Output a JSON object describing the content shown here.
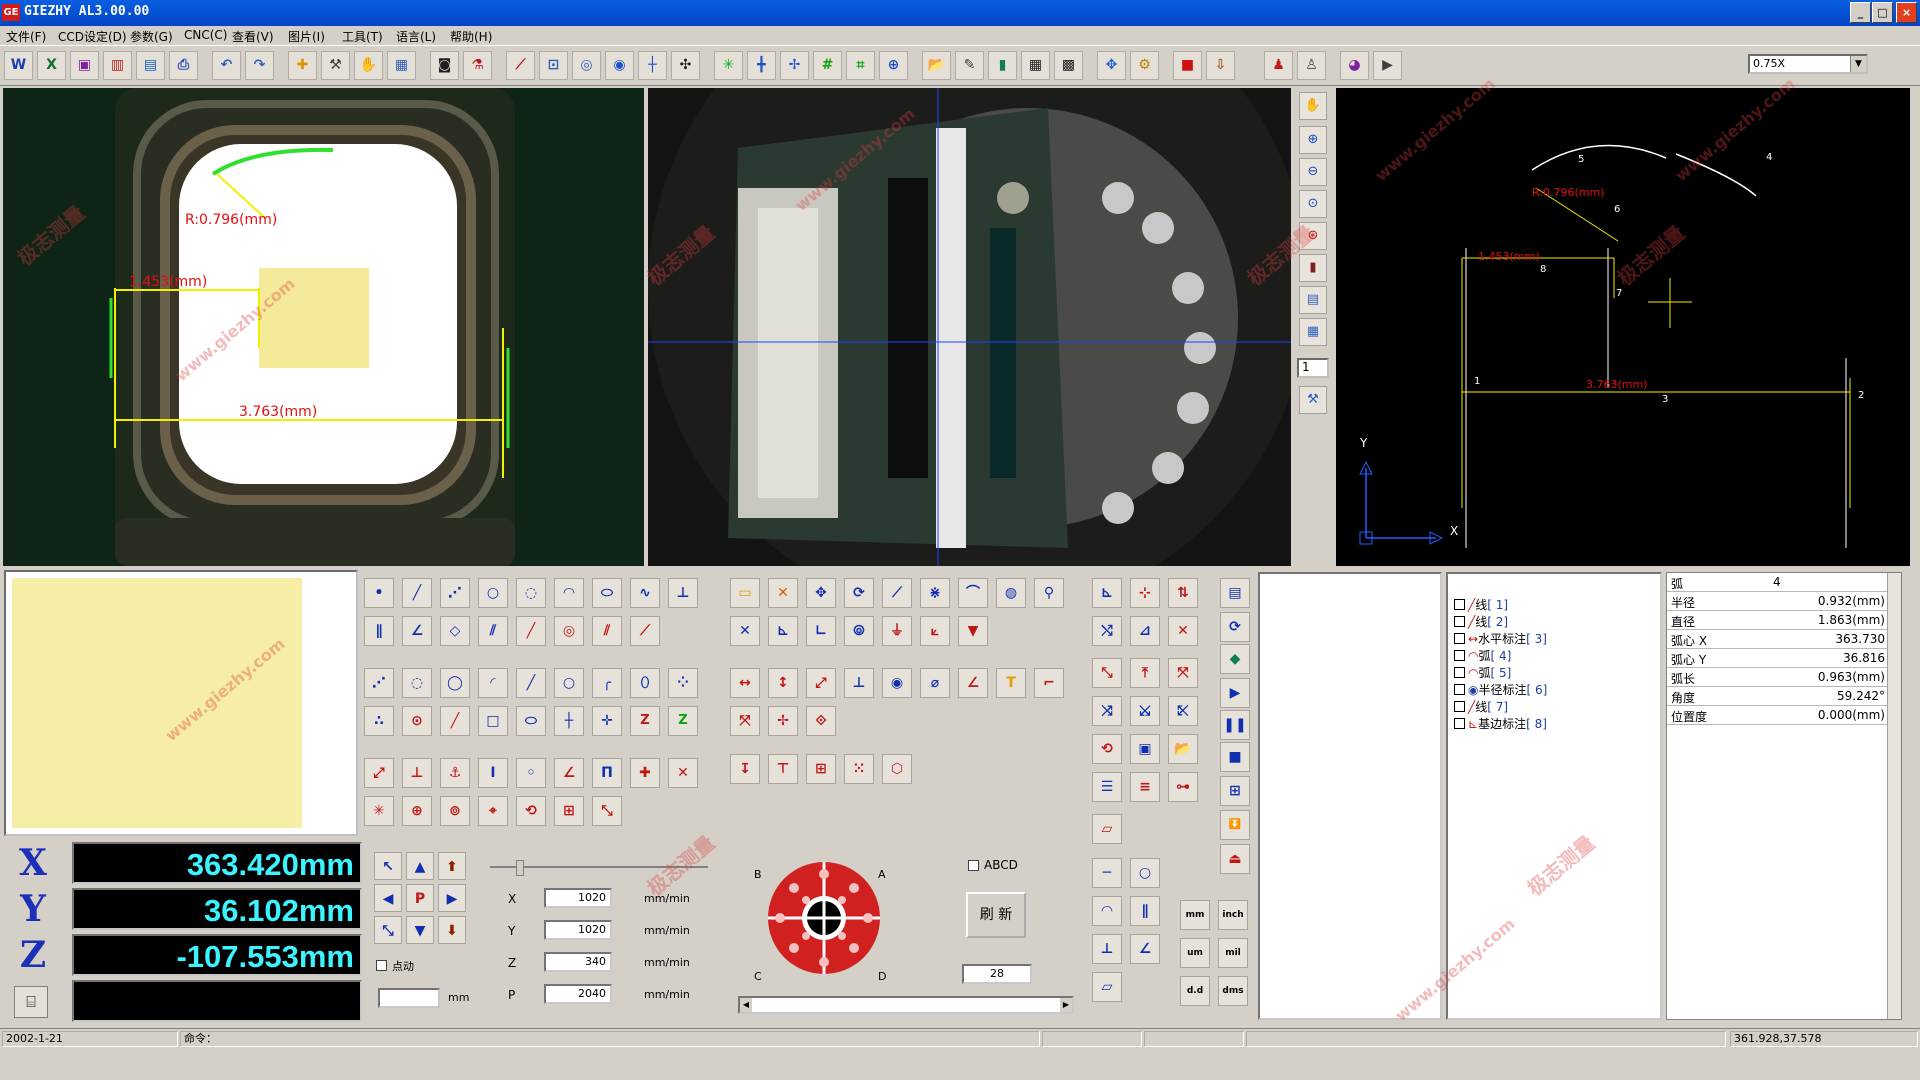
{
  "window": {
    "logo": "GE",
    "title": "GIEZHY AL3.00.00"
  },
  "menu": [
    "文件(F)",
    "CCD设定(D)",
    "参数(G)",
    "CNC(C)",
    "查看(V)",
    "图片(I)",
    "工具(T)",
    "语言(L)",
    "帮助(H)"
  ],
  "zoom": {
    "value": "0.75X"
  },
  "left_pane": {
    "radius_label": "R:0.796(mm)",
    "width_label": "1.453(mm)",
    "distance_label": "3.763(mm)"
  },
  "right_pane": {
    "radius_label": "R:0.796(mm)",
    "width_label": "1.453(mm)",
    "distance_label": "3.763(mm)",
    "point_labels": [
      "1",
      "2",
      "3",
      "4",
      "5",
      "6",
      "7",
      "8"
    ],
    "axis_x": "X",
    "axis_y": "Y"
  },
  "sidebar": {
    "page_input": "1"
  },
  "dro": {
    "x_label": "X",
    "y_label": "Y",
    "z_label": "Z",
    "x": "363.420mm",
    "y": "36.102mm",
    "z": "-107.553mm"
  },
  "motion": {
    "p_label": "P",
    "step_label": "点动",
    "step_unit": "mm",
    "rows": [
      {
        "axis": "X",
        "value": "1020",
        "unit": "mm/min"
      },
      {
        "axis": "Y",
        "value": "1020",
        "unit": "mm/min"
      },
      {
        "axis": "Z",
        "value": "340",
        "unit": "mm/min"
      },
      {
        "axis": "P",
        "value": "2040",
        "unit": "mm/min"
      }
    ]
  },
  "light": {
    "labels": [
      "A",
      "B",
      "C",
      "D"
    ],
    "abcd_label": "ABCD",
    "refresh_button": "刷 新",
    "level": "28"
  },
  "units": [
    "mm",
    "inch",
    "um",
    "mil",
    "d.d",
    "dms"
  ],
  "tree": [
    {
      "name": "线",
      "idx": "[ 1]"
    },
    {
      "name": "线",
      "idx": "[ 2]"
    },
    {
      "name": "水平标注",
      "idx": "[ 3]"
    },
    {
      "name": "弧",
      "idx": "[ 4]"
    },
    {
      "name": "弧",
      "idx": "[ 5]"
    },
    {
      "name": "半径标注",
      "idx": "[ 6]"
    },
    {
      "name": "线",
      "idx": "[ 7]"
    },
    {
      "name": "基边标注",
      "idx": "[ 8]"
    }
  ],
  "props": {
    "header": [
      "弧",
      "4"
    ],
    "rows": [
      [
        "半径",
        "0.932(mm)"
      ],
      [
        "直径",
        "1.863(mm)"
      ],
      [
        "弧心 X",
        "363.730"
      ],
      [
        "弧心 Y",
        "36.816"
      ],
      [
        "弧长",
        "0.963(mm)"
      ],
      [
        "角度",
        "59.242°"
      ],
      [
        "位置度",
        "0.000(mm)"
      ]
    ]
  },
  "status": {
    "date": "2002-1-21",
    "command_label": "命令：",
    "coords": "361.928,37.578"
  },
  "watermarks": [
    "极志测量",
    "www.giezhy.com"
  ]
}
